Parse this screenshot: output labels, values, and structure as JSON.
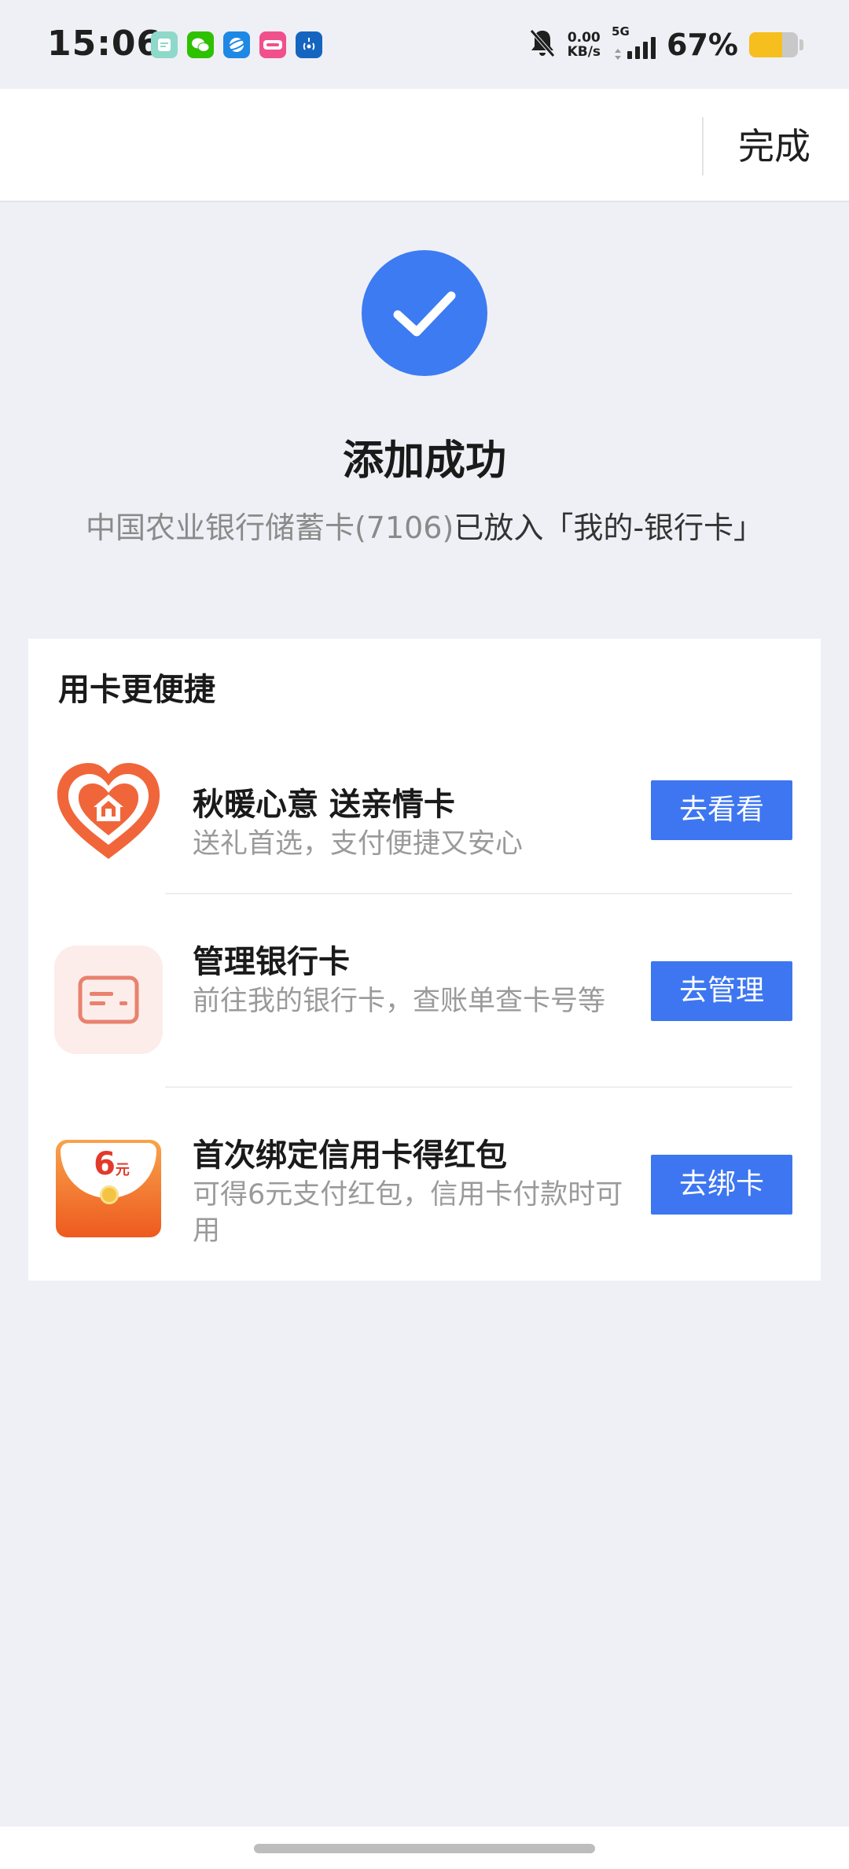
{
  "status_bar": {
    "time": "15:06",
    "apps": [
      {
        "icon": "notes-app-icon",
        "color": "#8ED9C9"
      },
      {
        "icon": "wechat-icon",
        "color": "#2DC100"
      },
      {
        "icon": "browser-icon",
        "color": "#1E88E5"
      },
      {
        "icon": "lala-app-icon",
        "color": "#F0508C"
      },
      {
        "icon": "hotspot-app-icon",
        "color": "#1565C0"
      }
    ],
    "net_speed_value": "0.00",
    "net_speed_unit": "KB/s",
    "network_gen": "5G",
    "battery_text": "67%",
    "battery_level": 0.67,
    "battery_color": "#F7BF1E"
  },
  "nav": {
    "done_label": "完成"
  },
  "success": {
    "title": "添加成功",
    "desc_grey": "中国农业银行储蓄卡(7106)",
    "desc_dark": "已放入「我的-银行卡」",
    "accent_color": "#3C7BF2"
  },
  "panel": {
    "title": "用卡更便捷",
    "items": [
      {
        "icon": "heart-house-icon",
        "title": "秋暖心意 送亲情卡",
        "subtitle": "送礼首选，支付便捷又安心",
        "button": "去看看"
      },
      {
        "icon": "bank-card-icon",
        "title": "管理银行卡",
        "subtitle": "前往我的银行卡，查账单查卡号等",
        "button": "去管理"
      },
      {
        "icon": "red-envelope-icon",
        "icon_text_num": "6",
        "icon_text_unit": "元",
        "title": "首次绑定信用卡得红包",
        "subtitle": "可得6元支付红包，信用卡付款时可用",
        "button": "去绑卡"
      }
    ]
  }
}
